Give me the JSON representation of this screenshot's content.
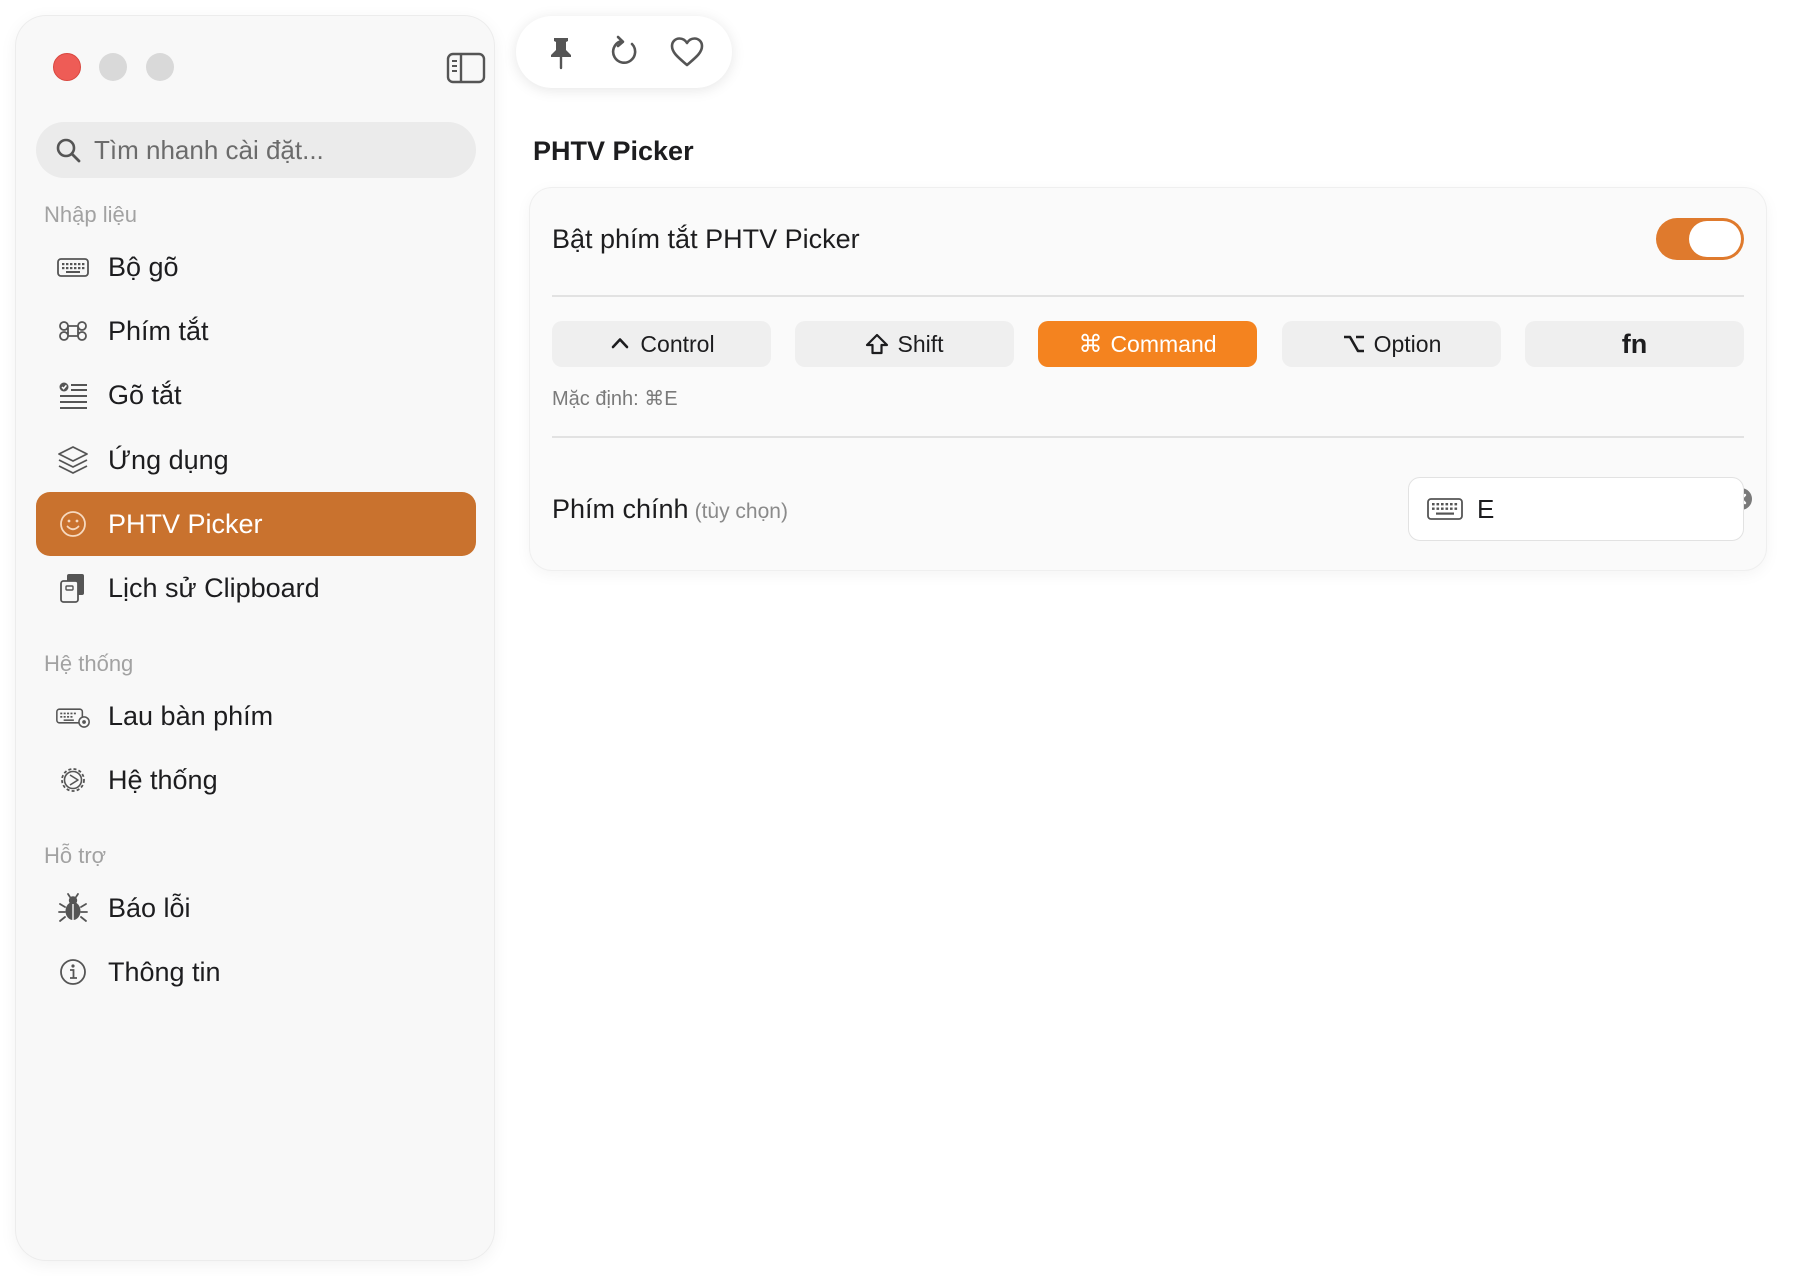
{
  "search": {
    "placeholder": "Tìm nhanh cài đặt..."
  },
  "sidebar": {
    "sections": [
      {
        "title": "Nhập liệu"
      },
      {
        "title": "Hệ thống"
      },
      {
        "title": "Hỗ trợ"
      }
    ],
    "items": [
      {
        "label": "Bộ gõ",
        "icon": "keyboard-icon"
      },
      {
        "label": "Phím tắt",
        "icon": "command-icon"
      },
      {
        "label": "Gõ tắt",
        "icon": "text-list-icon"
      },
      {
        "label": "Ứng dụng",
        "icon": "stack-icon"
      },
      {
        "label": "PHTV Picker",
        "icon": "smiley-icon",
        "active": true
      },
      {
        "label": "Lịch sử Clipboard",
        "icon": "clipboard-icon"
      },
      {
        "label": "Lau bàn phím",
        "icon": "keyboard-clean-icon"
      },
      {
        "label": "Hệ thống",
        "icon": "gear-icon"
      },
      {
        "label": "Báo lỗi",
        "icon": "bug-icon"
      },
      {
        "label": "Thông tin",
        "icon": "info-icon"
      }
    ]
  },
  "toolbar": {
    "icons": [
      "pin-icon",
      "refresh-icon",
      "heart-icon"
    ]
  },
  "main": {
    "title": "PHTV Picker",
    "toggle_label": "Bật phím tắt PHTV Picker",
    "toggle_on": true,
    "modifiers": [
      {
        "symbol": "⌃",
        "label": "Control",
        "active": false
      },
      {
        "symbol": "⇧",
        "label": "Shift",
        "active": false
      },
      {
        "symbol": "⌘",
        "label": "Command",
        "active": true
      },
      {
        "symbol": "⌥",
        "label": "Option",
        "active": false
      },
      {
        "symbol": "",
        "label": "fn",
        "active": false
      }
    ],
    "default_note": "Mặc định: ⌘E",
    "key_label": "Phím chính",
    "key_optional": "(tùy chọn)",
    "key_value": "E"
  },
  "colors": {
    "accent": "#c9722e",
    "toggle": "#df7a2d",
    "active_modifier": "#f4831f",
    "close": "#ee5c56"
  }
}
